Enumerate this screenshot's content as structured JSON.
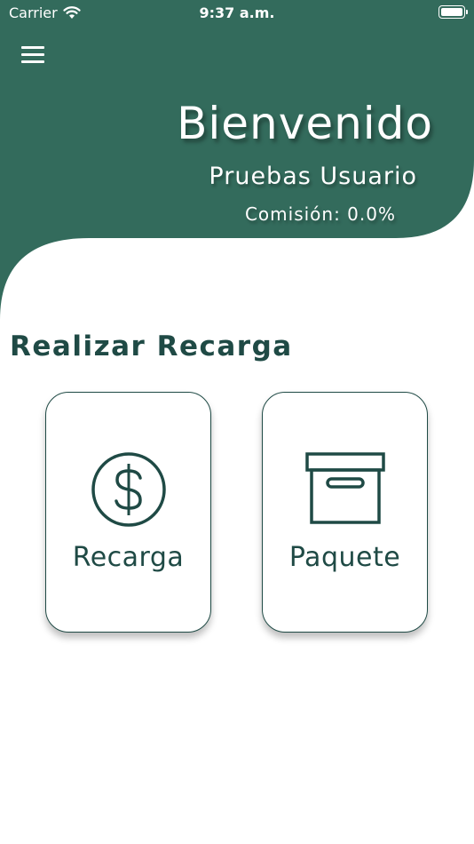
{
  "status_bar": {
    "carrier": "Carrier",
    "time": "9:37 a.m."
  },
  "header": {
    "welcome": "Bienvenido",
    "username": "Pruebas Usuario",
    "commission": "Comisión: 0.0%"
  },
  "section": {
    "title": "Realizar Recarga"
  },
  "cards": {
    "recarga": {
      "label": "Recarga",
      "icon": "dollar-circle-icon"
    },
    "paquete": {
      "label": "Paquete",
      "icon": "archive-box-icon"
    }
  },
  "colors": {
    "primary": "#336b5c",
    "text_dark": "#1f4a45",
    "background": "#ffffff"
  }
}
